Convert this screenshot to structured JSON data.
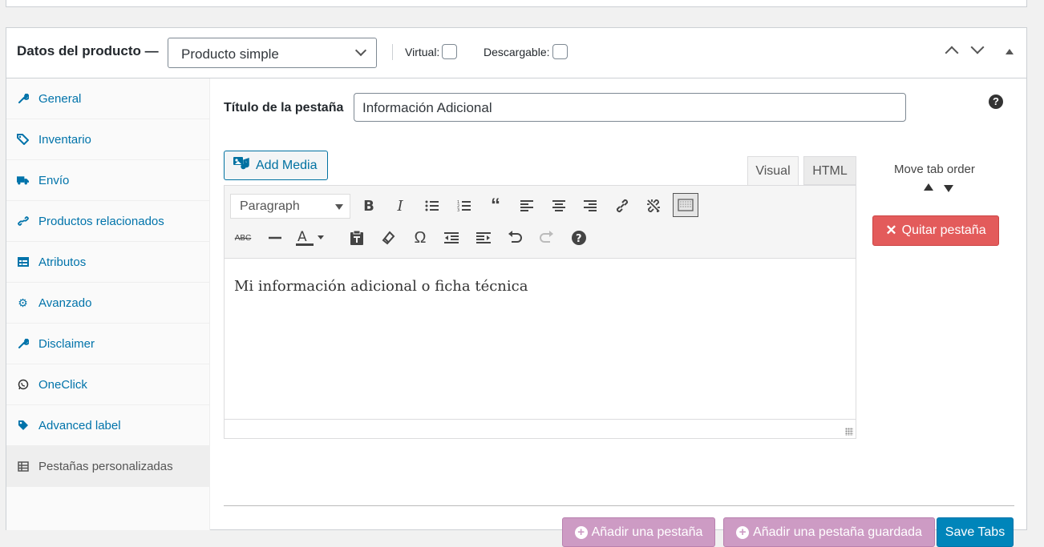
{
  "header": {
    "title": "Datos del producto —",
    "product_type": "Producto simple",
    "virtual_label": "Virtual:",
    "downloadable_label": "Descargable:"
  },
  "sidebar": {
    "items": [
      {
        "label": "General",
        "icon": "wrench-icon"
      },
      {
        "label": "Inventario",
        "icon": "tag-stack-icon"
      },
      {
        "label": "Envío",
        "icon": "truck-icon"
      },
      {
        "label": "Productos relacionados",
        "icon": "link-icon"
      },
      {
        "label": "Atributos",
        "icon": "table-icon"
      },
      {
        "label": "Avanzado",
        "icon": "gear-icon"
      },
      {
        "label": "Disclaimer",
        "icon": "wrench-icon"
      },
      {
        "label": "OneClick",
        "icon": "whatsapp-icon"
      },
      {
        "label": "Advanced label",
        "icon": "tag-icon"
      },
      {
        "label": "Pestañas personalizadas",
        "icon": "list-icon",
        "active": true
      }
    ]
  },
  "tab_editor": {
    "title_label": "Título de la pestaña",
    "title_value": "Información Adicional",
    "add_media": "Add Media",
    "tab_visual": "Visual",
    "tab_html": "HTML",
    "format_select": "Paragraph",
    "content": "Mi información adicional o ficha técnica",
    "move_tab_order": "Move tab order",
    "remove_tab": "Quitar pestaña"
  },
  "footer": {
    "add_tab": "Añadir una pestaña",
    "add_saved_tab": "Añadir una pestaña guardada",
    "save_tabs": "Save Tabs"
  },
  "colors": {
    "link": "#0073aa",
    "remove_button": "#e35b5b",
    "add_button": "#cd9bc4",
    "save_button": "#0085ba"
  }
}
